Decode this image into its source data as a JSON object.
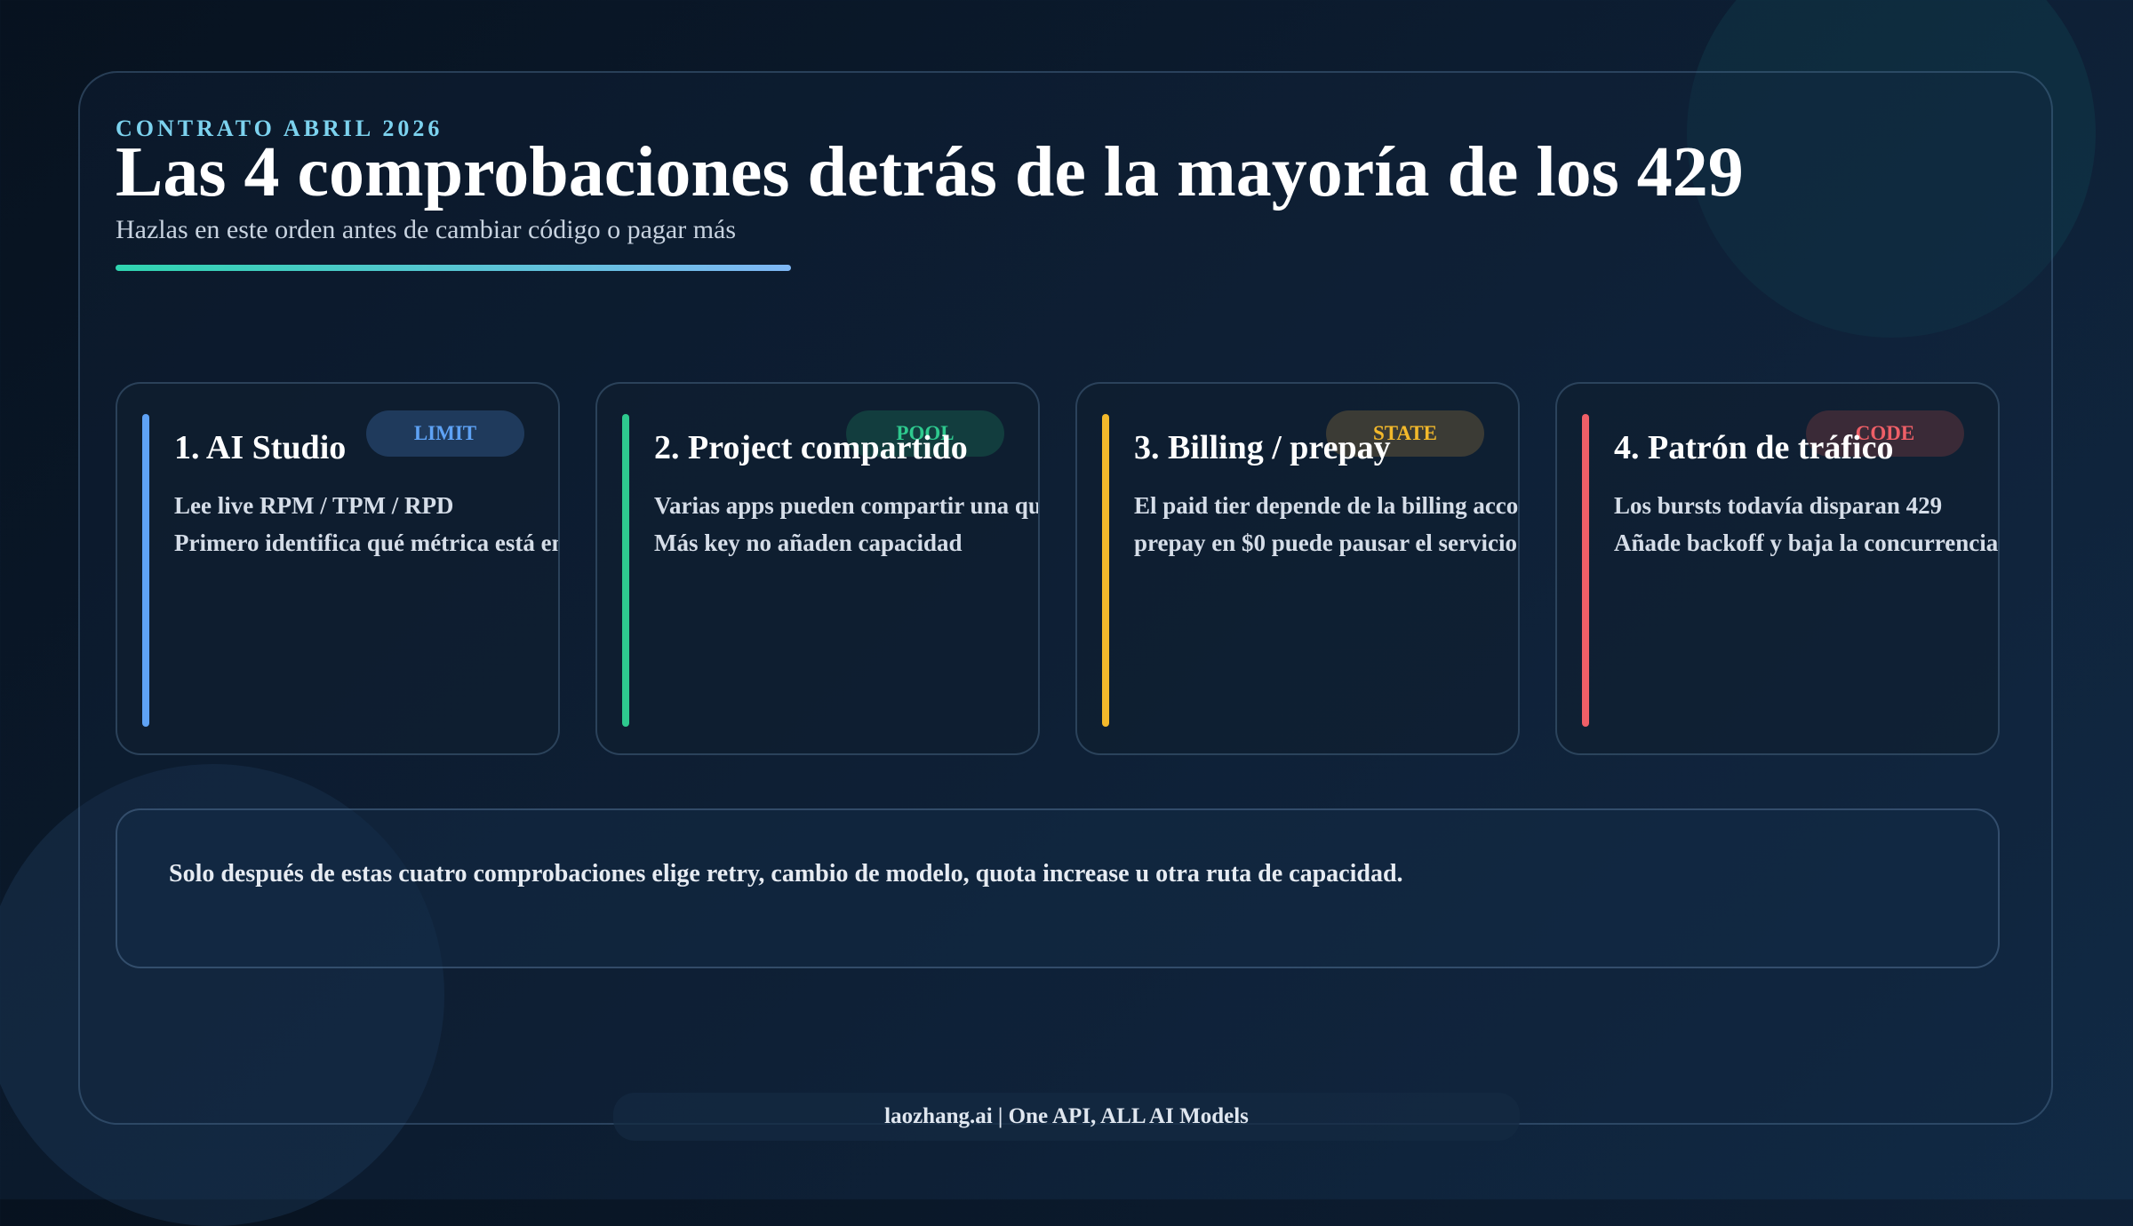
{
  "header": {
    "eyebrow": "CONTRATO ABRIL 2026",
    "title": "Las 4 comprobaciones detrás de la mayoría de los 429",
    "subtitle": "Hazlas en este orden antes de cambiar código o pagar más"
  },
  "cards": [
    {
      "title": "1. AI Studio",
      "badge": "LIMIT",
      "lines": [
        "Lee live RPM / TPM / RPD",
        "Primero identifica qué métrica está en r"
      ],
      "accent": "#5ea2f5",
      "badge_bg": "#1f3a5c"
    },
    {
      "title": "2. Project compartido",
      "badge": "POOL",
      "lines": [
        "Varias apps pueden compartir una quot",
        "Más key no añaden capacidad"
      ],
      "accent": "#2ec98e",
      "badge_bg": "#123d3e"
    },
    {
      "title": "3. Billing / prepay",
      "badge": "STATE",
      "lines": [
        "El paid tier depende de la billing accoun",
        "prepay en $0 puede pausar el servicio"
      ],
      "accent": "#f3b92b",
      "badge_bg": "#3b3b35"
    },
    {
      "title": "4. Patrón de tráfico",
      "badge": "CODE",
      "lines": [
        "Los bursts todavía disparan 429",
        "Añade backoff y baja la concurrencia"
      ],
      "accent": "#ef5f67",
      "badge_bg": "#3a2a37"
    }
  ],
  "note": {
    "text": "Solo después de estas cuatro comprobaciones elige retry, cambio de modelo, quota increase u otra ruta de capacidad."
  },
  "footer": {
    "text": "laozhang.ai | One API, ALL AI Models"
  }
}
